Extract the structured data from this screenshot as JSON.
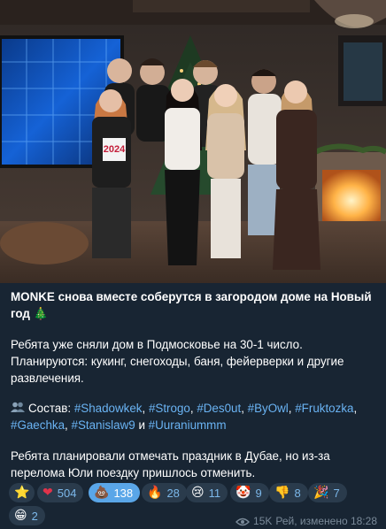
{
  "post": {
    "title": "MONKE снова вместе соберутся в загородом доме на Новый год",
    "title_emoji": "🎄",
    "paragraph1": "Ребята уже сняли дом в Подмосковье на 30-1 число. Планируются: кукинг, снегоходы, баня, фейерверки и другие развлечения.",
    "cast_icon": "people-icon",
    "cast_label": "Состав:",
    "hashtags": [
      "#Shadowkek",
      "#Strogo",
      "#Des0ut",
      "#ByOwl",
      "#Fruktozka",
      "#Gaechka",
      "#Stanislaw9",
      "#Uuraniummm"
    ],
    "cast_and": "и",
    "paragraph3": "Ребята планировали отмечать праздник в Дубае, но из-за перелома Юли поездку пришлось отменить.",
    "photo_sign": "2024"
  },
  "reactions": [
    {
      "emoji": "⭐",
      "icon": "star-icon",
      "count": ""
    },
    {
      "emoji": "❤",
      "icon": "heart-icon",
      "count": "504"
    },
    {
      "emoji": "💩",
      "icon": "poop-icon",
      "count": "138",
      "active": true
    },
    {
      "emoji": "🔥",
      "icon": "fire-icon",
      "count": "28"
    },
    {
      "emoji": "😢",
      "icon": "crying-face-icon",
      "count": "11"
    },
    {
      "emoji": "🤡",
      "icon": "clown-icon",
      "count": "9"
    },
    {
      "emoji": "👎",
      "icon": "thumbs-down-icon",
      "count": "8"
    },
    {
      "emoji": "🎉",
      "icon": "party-popper-icon",
      "count": "7"
    },
    {
      "emoji": "😁",
      "icon": "grinning-face-icon",
      "count": "2"
    }
  ],
  "meta": {
    "views": "15K",
    "author_edited": "Рей, изменено 18:28"
  }
}
